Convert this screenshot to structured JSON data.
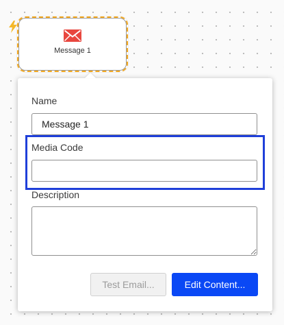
{
  "node": {
    "label": "Message 1",
    "icon": "envelope-icon",
    "icon_color": "#e8473f",
    "selection_color": "#f4a81d"
  },
  "trigger_icon": {
    "icon": "lightning-icon",
    "color": "#f4b82a"
  },
  "form": {
    "name_label": "Name",
    "name_value": "Message 1",
    "media_code_label": "Media Code",
    "media_code_value": "",
    "description_label": "Description",
    "description_value": ""
  },
  "buttons": {
    "test_email": "Test Email...",
    "edit_content": "Edit Content..."
  },
  "colors": {
    "primary": "#0a48f5",
    "highlight": "#1f3fd9"
  }
}
